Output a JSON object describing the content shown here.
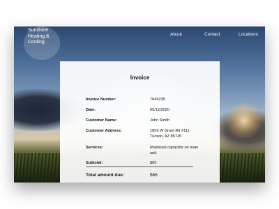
{
  "brand": {
    "name": "Sunshine Heating & Cooling",
    "logo_text": "Sunshine\nHeating &\nCooling"
  },
  "nav": {
    "items": [
      "About",
      "Contact",
      "Locations"
    ]
  },
  "invoice": {
    "title": "Invoice",
    "rows": [
      {
        "label": "Invoice Number:",
        "value": "7849235"
      },
      {
        "label": "Date:",
        "value": "05/12/2020"
      },
      {
        "label": "Customer Name:",
        "value": "John Smith"
      },
      {
        "label": "Customer Address:",
        "value": "1859 W Grant Rd #111 Tucson, AZ 85745"
      },
      {
        "label": "Services:",
        "value": "Replaced capacitor on main unit."
      },
      {
        "label": "Subtotal:",
        "value": "$65"
      }
    ],
    "total": {
      "label": "Total amount due:",
      "value": "$65"
    }
  },
  "colors": {
    "card_background": "#ffffff",
    "nav_text": "#ffffff",
    "body_text": "#111111"
  }
}
